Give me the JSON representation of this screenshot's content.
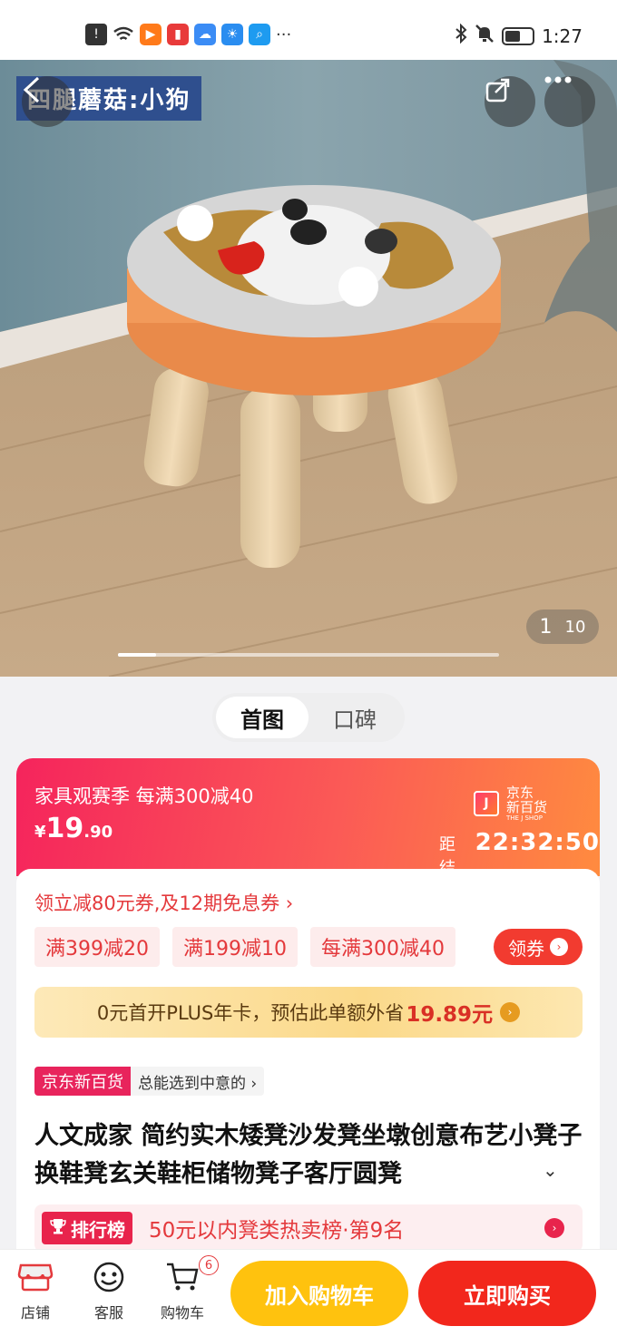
{
  "status_bar": {
    "time": "1:27",
    "notification_icons": [
      "alert-icon",
      "wifi-icon",
      "video-app-icon",
      "book-app-icon",
      "cloud-app-icon",
      "weather-app-icon",
      "search-app-icon",
      "more-icon"
    ],
    "right_icons": [
      "bluetooth-icon",
      "mute-icon",
      "battery-icon"
    ],
    "more_glyph": "···"
  },
  "hero": {
    "tag": "四腿蘑菇:小狗",
    "current_page": "1",
    "total_pages": "10",
    "progress_fraction": 0.1
  },
  "tabs": [
    "首图",
    "口碑"
  ],
  "promo": {
    "title": "家具观赛季 每满300减40",
    "price_currency": "¥",
    "price_int": "19",
    "price_dec": ".90",
    "logo_letter": "J",
    "logo_name": "京东\n新百货",
    "logo_sub": "THE J SHOP",
    "countdown_label": "距结束",
    "countdown_time": "22:32:50"
  },
  "coupons": {
    "link": "领立减80元券,及12期免息券 ›",
    "chips": [
      "满399减20",
      "满199减10",
      "每满300减40"
    ],
    "get_button": "领券",
    "get_arrow": "›"
  },
  "plus": {
    "text": "0元首开PLUS年卡，预估此单额外省",
    "amount": "19.89元",
    "arrow": "›"
  },
  "shop": {
    "name": "京东新百货",
    "slogan": "总能选到中意的 ›"
  },
  "product": {
    "title": "人文成家 简约实木矮凳沙发凳坐墩创意布艺小凳子换鞋凳玄关鞋柜储物凳子客厅圆凳",
    "expand_glyph": "⌄"
  },
  "rank": {
    "badge": "排行榜",
    "text": "50元以内凳类热卖榜·第9名",
    "arrow": "›"
  },
  "bottom": {
    "shop_label": "店铺",
    "service_label": "客服",
    "cart_label": "购物车",
    "cart_count": "6",
    "add_to_cart": "加入购物车",
    "buy_now": "立即购买"
  },
  "colors": {
    "accent_red": "#f2271c",
    "cart_yellow": "#ffc20e",
    "promo_pink": "#f5245c"
  }
}
